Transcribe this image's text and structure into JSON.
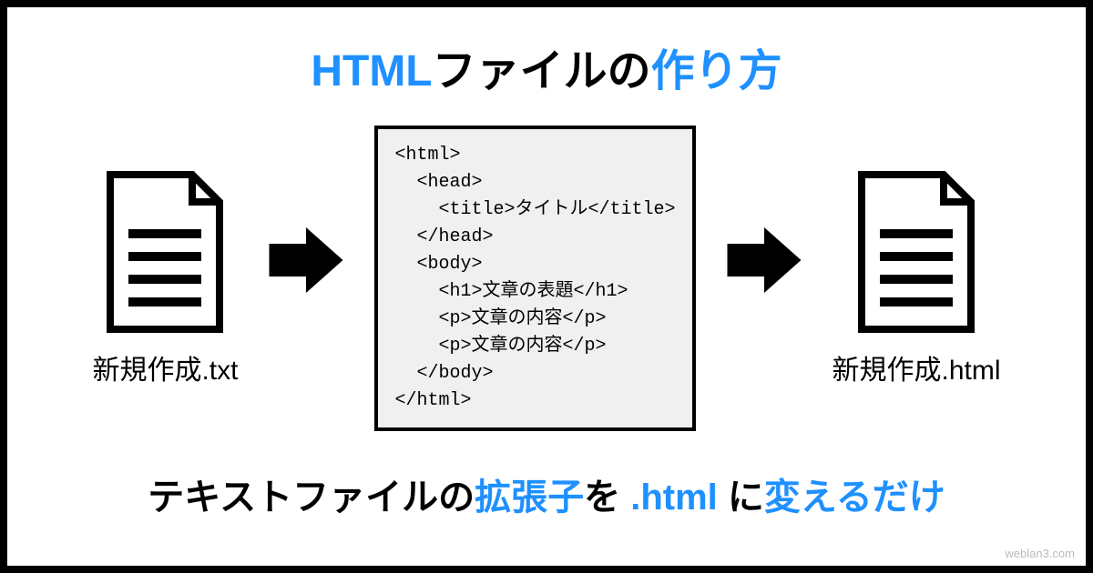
{
  "title": {
    "part1": "HTML",
    "part2": "ファイルの",
    "part3": "作り方"
  },
  "files": {
    "left_label": "新規作成.txt",
    "right_label": "新規作成.html"
  },
  "code": "<html>\n  <head>\n    <title>タイトル</title>\n  </head>\n  <body>\n    <h1>文章の表題</h1>\n    <p>文章の内容</p>\n    <p>文章の内容</p>\n  </body>\n</html>",
  "subtitle": {
    "part1": "テキストファイルの",
    "part2": "拡張子",
    "part3": "を ",
    "part4": ".html",
    "part5": " に",
    "part6": "変えるだけ"
  },
  "watermark": "weblan3.com"
}
